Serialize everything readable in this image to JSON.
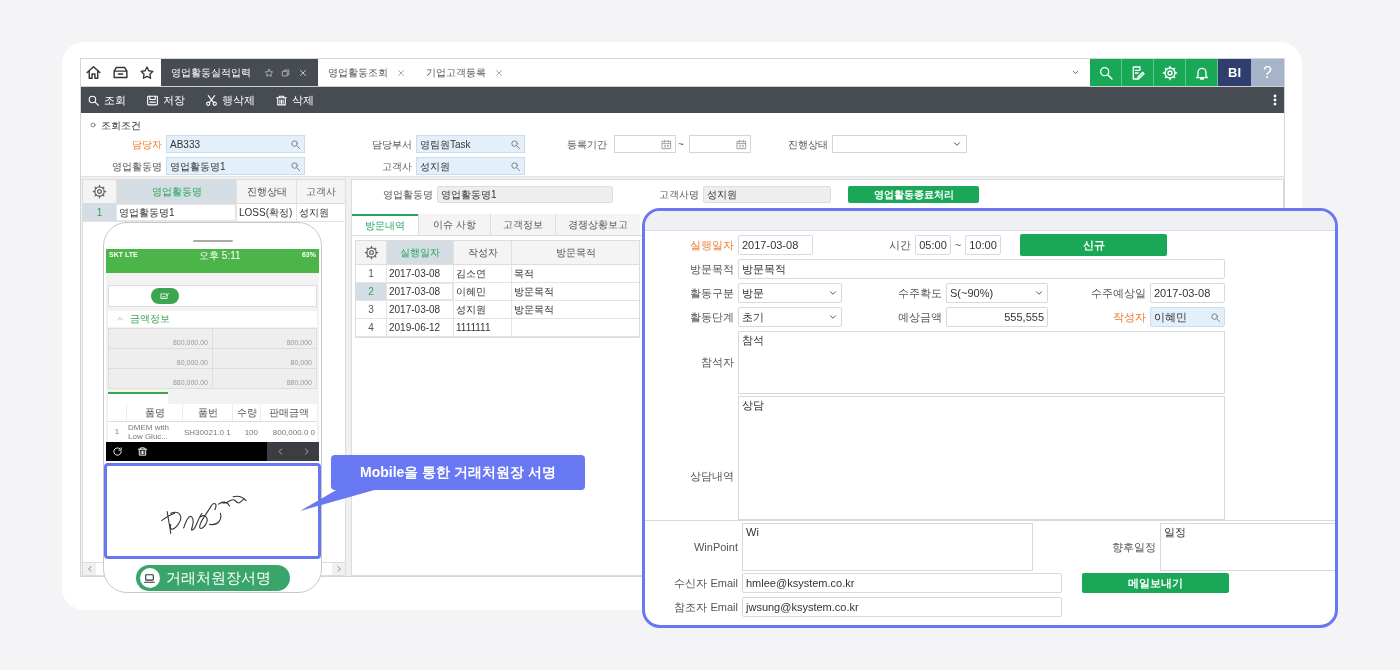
{
  "tabs": [
    {
      "label": "영업활동실적입력",
      "selected": true
    },
    {
      "label": "영업활동조회",
      "selected": false
    },
    {
      "label": "기업고객등록",
      "selected": false
    }
  ],
  "header_actions": {
    "user": "BI",
    "help": "?"
  },
  "toolbar": [
    {
      "label": "조회",
      "kind": "search"
    },
    {
      "label": "저장",
      "kind": "save"
    },
    {
      "label": "행삭제",
      "kind": "cut"
    },
    {
      "label": "삭제",
      "kind": "delete"
    }
  ],
  "search_title": "조회조건",
  "filters": [
    {
      "label": "담당자",
      "kind": "lookup",
      "value": "AB333",
      "required": true
    },
    {
      "label": "담당부서",
      "kind": "lookup",
      "value": "영림원Task",
      "required": false
    },
    {
      "label": "등록기간",
      "kind": "date_range",
      "separator": "~",
      "required": false
    },
    {
      "label": "진행상태",
      "kind": "select",
      "required": false
    },
    {
      "label": "영업활동명",
      "kind": "lookup",
      "value": "영업활동명1",
      "required": false
    },
    {
      "label": "고객사",
      "kind": "lookup",
      "value": "성지원",
      "required": false
    }
  ],
  "activity_grid": {
    "columns": [
      {
        "label": "영업활동명",
        "selected": true
      },
      {
        "label": "진행상태",
        "selected": false
      },
      {
        "label": "고객사",
        "selected": false
      }
    ],
    "rows": [
      {
        "no": "1",
        "cells": [
          "영업활동명1",
          "LOSS(확정)",
          "성지원"
        ],
        "selected": true
      }
    ]
  },
  "activity_header": {
    "name_label": "영업활동명",
    "name_value": "영업활동명1",
    "customer_label": "고객사명",
    "customer_value": "성지원",
    "close_button": "영업활동종료처리"
  },
  "detail_tabs": [
    {
      "label": "방문내역",
      "selected": true
    },
    {
      "label": "이슈 사항",
      "selected": false
    },
    {
      "label": "고객정보",
      "selected": false
    },
    {
      "label": "경쟁상황보고",
      "selected": false
    }
  ],
  "visit_grid": {
    "columns": [
      {
        "label": "실행일자",
        "selected": true
      },
      {
        "label": "작성자",
        "selected": false
      },
      {
        "label": "방문목적",
        "selected": false
      }
    ],
    "rows": [
      {
        "no": "1",
        "cells": [
          "2017-03-08",
          "김소연",
          "목적"
        ],
        "selected": false
      },
      {
        "no": "2",
        "cells": [
          "2017-03-08",
          "이혜민",
          "방문목적"
        ],
        "selected": true
      },
      {
        "no": "3",
        "cells": [
          "2017-03-08",
          "성지원",
          "방문목적"
        ],
        "selected": false
      },
      {
        "no": "4",
        "cells": [
          "2019-06-12",
          "1111111"
        ],
        "selected": false
      }
    ]
  },
  "mobile": {
    "carrier": "SKT  LTE",
    "time": "오후 5:11",
    "battery": "63%",
    "amount_section": "금액정보",
    "amounts": [
      {
        "cells": [
          "800,000.00",
          "800,000"
        ]
      },
      {
        "cells": [
          "80,000.00",
          "80,000"
        ]
      },
      {
        "cells": [
          "880,000.00",
          "880,000"
        ]
      }
    ],
    "items": {
      "columns": [
        "품명",
        "품번",
        "수량",
        "판매금액"
      ],
      "rows": [
        {
          "no": "1",
          "cells": [
            "DMEM with Low Gluc...",
            "SH30021.0 1",
            "100",
            "800,000.0 0"
          ]
        }
      ]
    },
    "sign_label": "거래처원장서명"
  },
  "callout": "Mobile을 통한 거래처원장 서명",
  "visit_form": {
    "date": {
      "label": "실행일자",
      "value": "2017-03-08",
      "required": true
    },
    "time": {
      "label": "시간",
      "from": "05:00",
      "separator": "~",
      "to": "10:00"
    },
    "new_button": "신규",
    "purpose": {
      "label": "방문목적",
      "value": "방문목적"
    },
    "activity_type": {
      "label": "활동구분",
      "value": "방문"
    },
    "probability": {
      "label": "수주확도",
      "value": "S(~90%)"
    },
    "expected_date": {
      "label": "수주예상일",
      "value": "2017-03-08"
    },
    "stage": {
      "label": "활동단계",
      "value": "초기"
    },
    "expected_amount": {
      "label": "예상금액",
      "value": "555,555"
    },
    "writer": {
      "label": "작성자",
      "value": "이혜민",
      "required": true
    },
    "attendees": {
      "label": "참석자",
      "value": "참석"
    },
    "consultation": {
      "label": "상담내역",
      "value": "상담"
    },
    "winpoint": {
      "label": "WinPoint",
      "value": "Wi"
    },
    "schedule": {
      "label": "향후일정",
      "value": "일정"
    },
    "to_email": {
      "label": "수신자 Email",
      "value": "hmlee@ksystem.co.kr"
    },
    "cc_email": {
      "label": "참조자 Email",
      "value": "jwsung@ksystem.co.kr"
    },
    "mail_button": "메일보내기"
  }
}
